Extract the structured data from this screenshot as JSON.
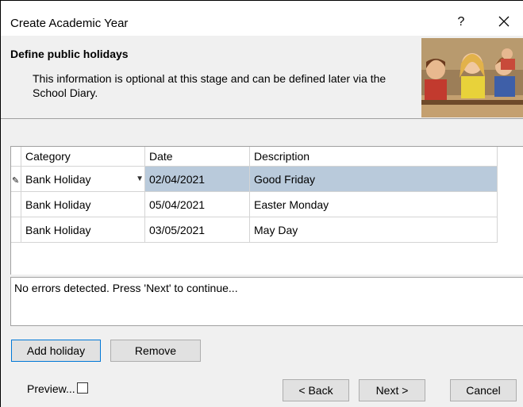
{
  "window": {
    "title": "Create Academic Year",
    "help_label": "?"
  },
  "header": {
    "title": "Define public holidays",
    "description": "This information is optional at this stage and can be defined later via the School Diary."
  },
  "grid": {
    "columns": [
      "Category",
      "Date",
      "Description"
    ],
    "rows": [
      {
        "category": "Bank Holiday",
        "date": "02/04/2021",
        "description": "Good Friday",
        "selected": true
      },
      {
        "category": "Bank Holiday",
        "date": "05/04/2021",
        "description": "Easter Monday"
      },
      {
        "category": "Bank Holiday",
        "date": "03/05/2021",
        "description": "May Day"
      }
    ]
  },
  "status": {
    "message": "No errors detected. Press 'Next' to continue..."
  },
  "buttons": {
    "add_holiday": "Add holiday",
    "remove": "Remove",
    "preview": "Preview...",
    "back": "< Back",
    "next": "Next >",
    "cancel": "Cancel"
  },
  "colors": {
    "selection": "#b9cadb",
    "focus": "#0078d7",
    "dialog_bg": "#f0f0f0"
  }
}
